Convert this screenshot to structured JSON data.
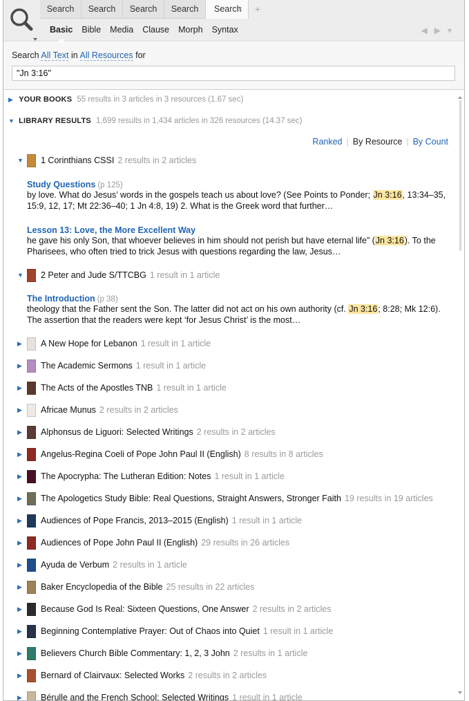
{
  "tabs": [
    {
      "label": "Search"
    },
    {
      "label": "Search"
    },
    {
      "label": "Search"
    },
    {
      "label": "Search"
    },
    {
      "label": "Search",
      "active": true
    }
  ],
  "tab_close": "×",
  "new_tab": "+",
  "subnav": [
    "Basic",
    "Bible",
    "Media",
    "Clause",
    "Morph",
    "Syntax"
  ],
  "nav_arrows": {
    "back": "◀",
    "forward": "▶",
    "menu": "▾"
  },
  "search": {
    "prefix": "Search",
    "scope_text": "All Text",
    "in_word": "in",
    "scope_resources": "All Resources",
    "for_word": "for",
    "query": "\"Jn 3:16\""
  },
  "your_books": {
    "title": "YOUR BOOKS",
    "meta": "55 results in 3 articles in 3 resources (1.67 sec)"
  },
  "library_results": {
    "title": "LIBRARY RESULTS",
    "meta": "1,699 results in 1,434 articles in 326 resources (14.37 sec)"
  },
  "sort": {
    "ranked": "Ranked",
    "by_resource": "By Resource",
    "by_count": "By Count"
  },
  "expanded": [
    {
      "title": "1 Corinthians CSSI",
      "meta": "2 results in 2 articles",
      "cover": "#c58a3b",
      "articles": [
        {
          "title": "Study Questions",
          "page": "(p 125)",
          "before": "by love. What do Jesus’ words in the gospels teach us about love? (See Points to Ponder; ",
          "hit": "Jn 3:16",
          "after": ", 13:34–35, 15:9, 12, 17; Mt 22:36–40; 1 Jn 4:8, 19) 2.    What is the Greek word that further…"
        },
        {
          "title": "Lesson 13: Love, the More Excellent Way",
          "page": "",
          "before": "he gave his only Son, that whoever believes in him should not perish but have eternal life” (",
          "hit": "Jn 3:16",
          "after": "). To the Pharisees, who often tried to trick Jesus with questions regarding the law, Jesus…"
        }
      ]
    },
    {
      "title": "2 Peter and Jude S/TTCBG",
      "meta": "1 result in 1 article",
      "cover": "#a0432c",
      "articles": [
        {
          "title": "The Introduction",
          "page": "(p 38)",
          "before": "theology that the Father sent the Son. The latter did not act on his own authority (cf. ",
          "hit": "Jn 3:16",
          "after": "; 8:28; Mk 12:6). The assertion that the readers were kept ‘for Jesus Christ’ is the most…"
        }
      ]
    }
  ],
  "collapsed": [
    {
      "title": "A New Hope for Lebanon",
      "meta": "1 result in 1 article",
      "cover": "#e8e2de"
    },
    {
      "title": "The Academic Sermons",
      "meta": "1 result in 1 article",
      "cover": "#b58dc2"
    },
    {
      "title": "The Acts of the Apostles TNB",
      "meta": "1 result in 1 article",
      "cover": "#5a3a2e"
    },
    {
      "title": "Africae Munus",
      "meta": "2 results in 2 articles",
      "cover": "#f0e8e4"
    },
    {
      "title": "Alphonsus de Liguori: Selected Writings",
      "meta": "2 results in 2 articles",
      "cover": "#5b3b34"
    },
    {
      "title": "Angelus-Regina Coeli of Pope John Paul II (English)",
      "meta": "8 results in 8 articles",
      "cover": "#8e2a22"
    },
    {
      "title": "The Apocrypha: The Lutheran Edition: Notes",
      "meta": "1 result in 1 article",
      "cover": "#4a1028"
    },
    {
      "title": "The Apologetics Study Bible: Real Questions, Straight Answers, Stronger Faith",
      "meta": "19 results in 19 articles",
      "cover": "#6e6e5a"
    },
    {
      "title": "Audiences of Pope Francis, 2013–2015 (English)",
      "meta": "1 result in 1 article",
      "cover": "#1e3a5a"
    },
    {
      "title": "Audiences of Pope John Paul II (English)",
      "meta": "29 results in 26 articles",
      "cover": "#8e2a22"
    },
    {
      "title": "Ayuda de Verbum",
      "meta": "2 results in 1 article",
      "cover": "#1d4f8c"
    },
    {
      "title": "Baker Encyclopedia of the Bible",
      "meta": "25 results in 22 articles",
      "cover": "#9c8254"
    },
    {
      "title": "Because God Is Real: Sixteen Questions, One Answer",
      "meta": "2 results in 2 articles",
      "cover": "#2b2b2b"
    },
    {
      "title": "Beginning Contemplative Prayer: Out of Chaos into Quiet",
      "meta": "1 result in 1 article",
      "cover": "#28324a"
    },
    {
      "title": "Believers Church Bible Commentary: 1, 2, 3 John",
      "meta": "2 results in 1 article",
      "cover": "#2f7a6a"
    },
    {
      "title": "Bernard of Clairvaux: Selected Works",
      "meta": "2 results in 2 articles",
      "cover": "#a8502e"
    },
    {
      "title": "Bérulle and the French School: Selected Writings",
      "meta": "1 result in 1 article",
      "cover": "#c9b79a"
    }
  ]
}
